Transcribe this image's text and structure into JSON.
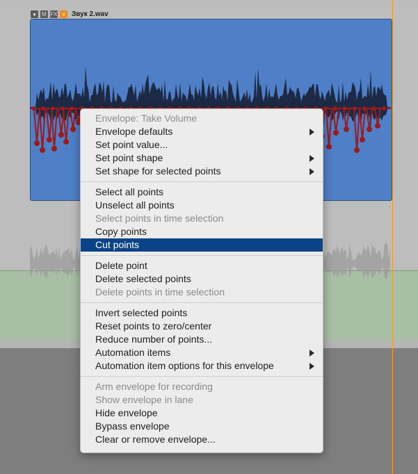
{
  "item": {
    "name": "Звук 2.wav",
    "lock_label": "",
    "m_label": "M",
    "fx_label": "FX"
  },
  "menu": {
    "header": "Envelope: Take Volume",
    "group1": [
      {
        "label": "Envelope defaults",
        "submenu": true,
        "disabled": false
      },
      {
        "label": "Set point value...",
        "submenu": false,
        "disabled": false
      },
      {
        "label": "Set point shape",
        "submenu": true,
        "disabled": false
      },
      {
        "label": "Set shape for selected points",
        "submenu": true,
        "disabled": false
      }
    ],
    "group2": [
      {
        "label": "Select all points",
        "disabled": false
      },
      {
        "label": "Unselect all points",
        "disabled": false
      },
      {
        "label": "Select points in time selection",
        "disabled": true
      },
      {
        "label": "Copy points",
        "disabled": false
      },
      {
        "label": "Cut points",
        "disabled": false,
        "highlighted": true
      }
    ],
    "group3": [
      {
        "label": "Delete point",
        "disabled": false
      },
      {
        "label": "Delete selected points",
        "disabled": false
      },
      {
        "label": "Delete points in time selection",
        "disabled": true
      }
    ],
    "group4": [
      {
        "label": "Invert selected points",
        "disabled": false
      },
      {
        "label": "Reset points to zero/center",
        "disabled": false
      },
      {
        "label": "Reduce number of points...",
        "disabled": false
      },
      {
        "label": "Automation items",
        "submenu": true,
        "disabled": false
      },
      {
        "label": "Automation item options for this envelope",
        "submenu": true,
        "disabled": false
      }
    ],
    "group5": [
      {
        "label": "Arm envelope for recording",
        "disabled": true
      },
      {
        "label": "Show envelope in lane",
        "disabled": true
      },
      {
        "label": "Hide envelope",
        "disabled": false
      },
      {
        "label": "Bypass envelope",
        "disabled": false
      },
      {
        "label": "Clear or remove envelope...",
        "disabled": false
      }
    ]
  },
  "colors": {
    "item_bg": "#4f7fc6",
    "envelope": "#9a1b1b",
    "highlight": "#0a4388",
    "playhead": "#e8a12a"
  }
}
